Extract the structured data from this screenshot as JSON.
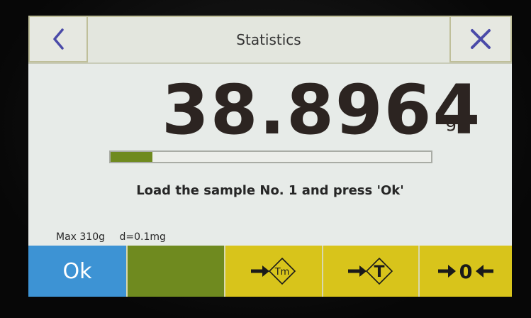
{
  "titlebar": {
    "title": "Statistics",
    "back_icon": "chevron-left-icon",
    "close_icon": "close-icon",
    "accent_color": "#4a4aa8"
  },
  "reading": {
    "value": "38.8964",
    "unit": "g"
  },
  "progress": {
    "fraction": 0.13,
    "fill_color": "#6f8a1f"
  },
  "message": "Load the sample No. 1 and press 'Ok'",
  "specs": {
    "max": "Max 310g",
    "d": "d=0.1mg"
  },
  "buttons": {
    "ok_label": "Ok",
    "tare_memory_icon": "tare-memory-icon",
    "tare_memory_glyph": "Tm",
    "tare_icon": "tare-icon",
    "tare_glyph": "T",
    "zero_icon": "zero-icon",
    "zero_glyph": "0",
    "ok_color": "#3d93d4",
    "function_color": "#d8c41b"
  }
}
